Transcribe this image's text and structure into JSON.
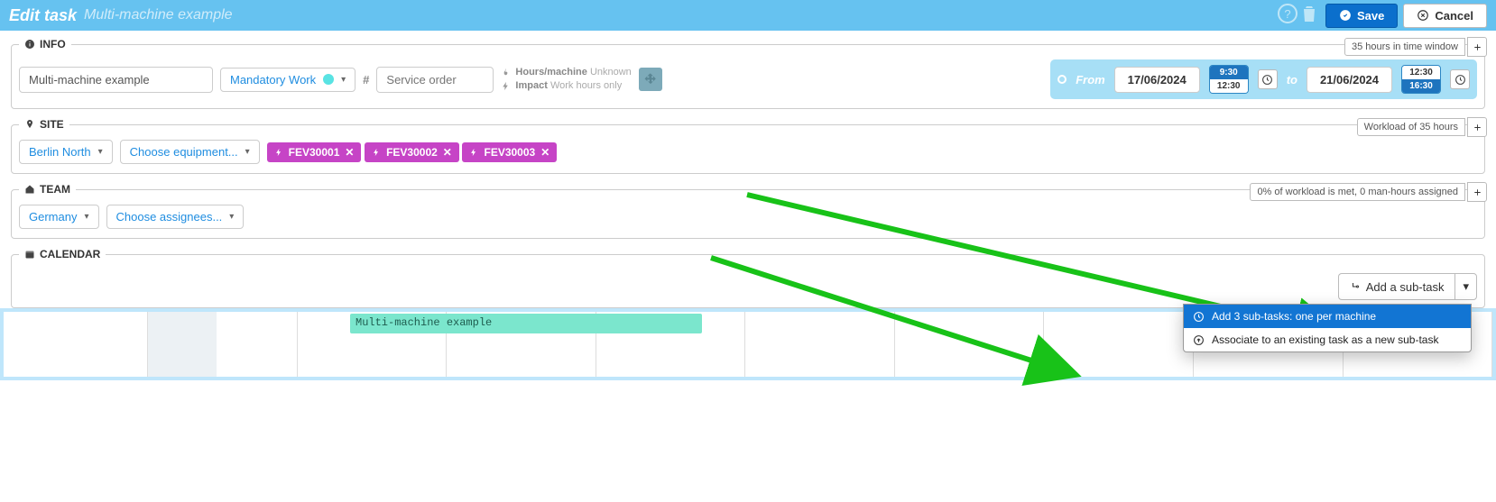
{
  "header": {
    "title": "Edit task",
    "subtitle": "Multi-machine example",
    "save_label": "Save",
    "cancel_label": "Cancel"
  },
  "info": {
    "legend": "INFO",
    "task_name": "Multi-machine example",
    "work_type_label": "Mandatory Work",
    "service_order_placeholder": "Service order",
    "hours_machine_label": "Hours/machine",
    "hours_machine_value": "Unknown",
    "impact_label": "Impact",
    "impact_value": "Work hours only",
    "badge": "35 hours in time window",
    "daterange": {
      "from_label": "From",
      "from_date": "17/06/2024",
      "from_time_top": "9:30",
      "from_time_bottom": "12:30",
      "to_label": "to",
      "to_date": "21/06/2024",
      "to_time_top": "12:30",
      "to_time_bottom": "16:30"
    }
  },
  "site": {
    "legend": "SITE",
    "location": "Berlin North",
    "choose_equipment_label": "Choose equipment...",
    "tags": [
      "FEV30001",
      "FEV30002",
      "FEV30003"
    ],
    "badge": "Workload of 35 hours"
  },
  "team": {
    "legend": "TEAM",
    "region": "Germany",
    "choose_assignees_label": "Choose assignees...",
    "badge": "0% of workload is met, 0 man-hours assigned"
  },
  "calendar": {
    "legend": "CALENDAR",
    "add_subtask_label": "Add a sub-task",
    "task_bar_label": "Multi-machine example",
    "menu": {
      "item1": "Add 3 sub-tasks: one per machine",
      "item2": "Associate to an existing task as a new sub-task"
    }
  }
}
